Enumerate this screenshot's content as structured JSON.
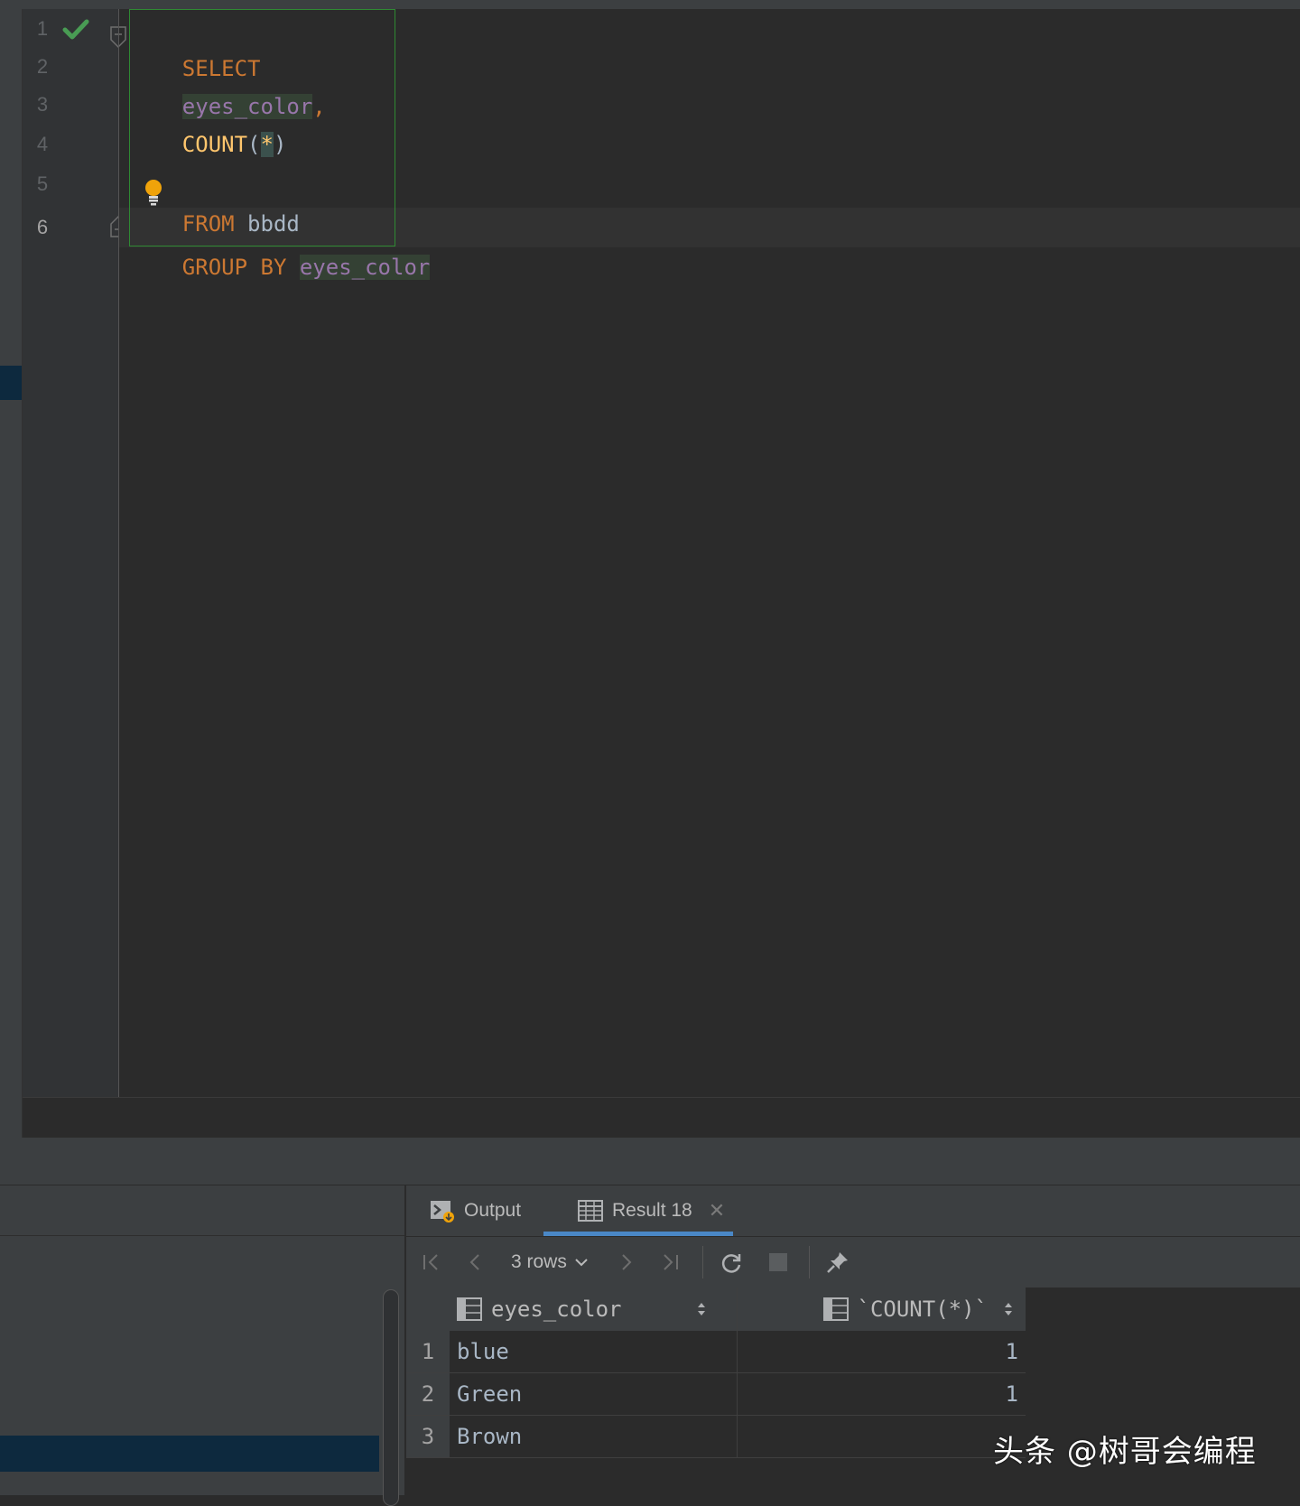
{
  "editor": {
    "line_numbers": [
      "1",
      "2",
      "3",
      "4",
      "5",
      "6"
    ],
    "code": {
      "line1_kw": "SELECT",
      "line2_ident": "eyes_color",
      "line2_punct": ",",
      "line3_fn": "COUNT",
      "line3_open": "(",
      "line3_star": "*",
      "line3_close": ")",
      "line5_kw": "FROM",
      "line5_table": "bbdd",
      "line6_kw": "GROUP BY",
      "line6_ident": "eyes_color"
    }
  },
  "results": {
    "tabs": {
      "output_label": "Output",
      "result_label": "Result 18"
    },
    "toolbar": {
      "rows_label": "3 rows"
    },
    "columns": [
      "eyes_color",
      "`COUNT(*)`"
    ],
    "rows": [
      {
        "num": "1",
        "eyes_color": "blue",
        "count": "1"
      },
      {
        "num": "2",
        "eyes_color": "Green",
        "count": "1"
      },
      {
        "num": "3",
        "eyes_color": "Brown",
        "count": ""
      }
    ]
  },
  "watermark": "头条 @树哥会编程",
  "colors": {
    "keyword": "#cc7832",
    "function": "#ffc66d",
    "column": "#9876aa",
    "accent_tab": "#4a88c7",
    "success_check": "#499c54",
    "selection": "#0d293e"
  },
  "icons": {
    "gutter_status": "check-icon",
    "intention": "lightbulb-icon",
    "fold": "fold-icon",
    "output_tab": "console-icon",
    "result_tab": "table-icon"
  }
}
